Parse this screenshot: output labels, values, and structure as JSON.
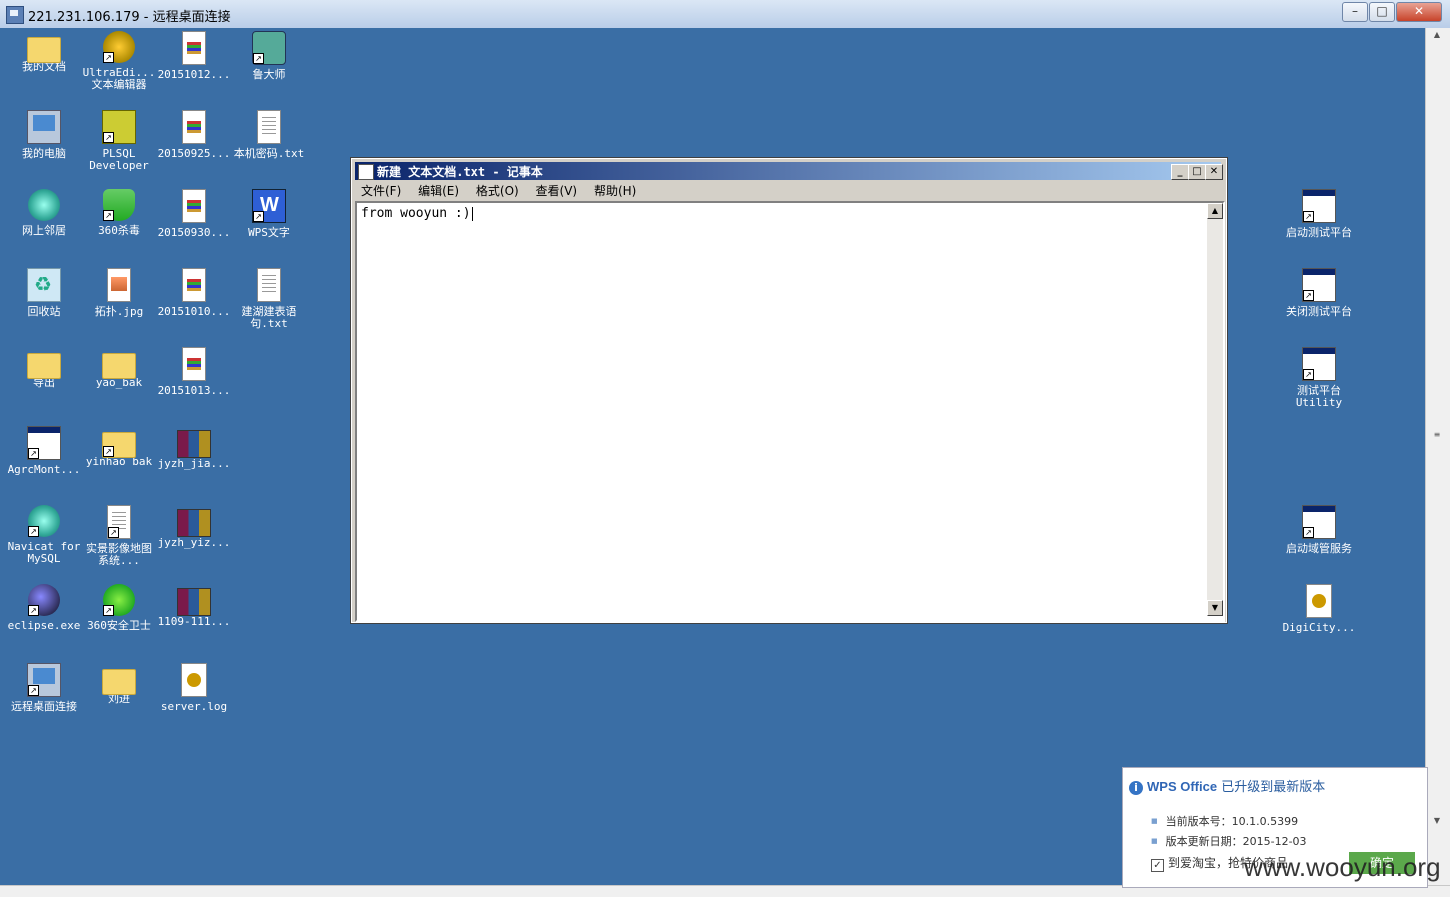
{
  "window": {
    "title": "221.231.106.179 - 远程桌面连接",
    "minimize": "–",
    "maximize": "□",
    "close": "✕"
  },
  "desktop_icons_left": [
    {
      "label": "我的文档",
      "icon": "documents-folder-icon",
      "kind": "folder",
      "shortcut": false
    },
    {
      "label": "UltraEdi... 文本编辑器",
      "icon": "ultraedit-icon",
      "kind": "ue",
      "shortcut": true
    },
    {
      "label": "20151012...",
      "icon": "doc-file-icon",
      "kind": "doc",
      "shortcut": false
    },
    {
      "label": "鲁大师",
      "icon": "ludashi-icon",
      "kind": "ludashi",
      "shortcut": true
    },
    {
      "label": "我的电脑",
      "icon": "my-computer-icon",
      "kind": "computer",
      "shortcut": false
    },
    {
      "label": "PLSQL Developer",
      "icon": "plsql-icon",
      "kind": "plsql",
      "shortcut": true
    },
    {
      "label": "20150925...",
      "icon": "doc-file-icon",
      "kind": "doc",
      "shortcut": false
    },
    {
      "label": "本机密码.txt",
      "icon": "text-file-icon",
      "kind": "txt",
      "shortcut": false
    },
    {
      "label": "网上邻居",
      "icon": "network-icon",
      "kind": "globe",
      "shortcut": false
    },
    {
      "label": "360杀毒",
      "icon": "360-antivirus-icon",
      "kind": "shield",
      "shortcut": true
    },
    {
      "label": "20150930...",
      "icon": "doc-file-icon",
      "kind": "doc",
      "shortcut": false
    },
    {
      "label": "WPS文字",
      "icon": "wps-writer-icon",
      "kind": "wps",
      "shortcut": true
    },
    {
      "label": "回收站",
      "icon": "recycle-bin-icon",
      "kind": "recycle",
      "shortcut": false
    },
    {
      "label": "拓扑.jpg",
      "icon": "image-file-icon",
      "kind": "jpg",
      "shortcut": false
    },
    {
      "label": "20151010...",
      "icon": "doc-file-icon",
      "kind": "doc",
      "shortcut": false
    },
    {
      "label": "建湖建表语句.txt",
      "icon": "text-file-icon",
      "kind": "txt",
      "shortcut": false
    },
    {
      "label": "导出",
      "icon": "folder-icon",
      "kind": "folder",
      "shortcut": false
    },
    {
      "label": "yao_bak",
      "icon": "folder-icon",
      "kind": "folder",
      "shortcut": false
    },
    {
      "label": "20151013...",
      "icon": "doc-file-icon",
      "kind": "doc",
      "shortcut": false
    },
    {
      "label": "",
      "icon": "",
      "kind": "",
      "shortcut": false
    },
    {
      "label": "AgrcMont...",
      "icon": "app-window-icon",
      "kind": "app",
      "shortcut": true
    },
    {
      "label": "yinhao bak",
      "icon": "folder-icon",
      "kind": "folder",
      "shortcut": true
    },
    {
      "label": "jyzh_jia...",
      "icon": "rar-archive-icon",
      "kind": "rar",
      "shortcut": false
    },
    {
      "label": "",
      "icon": "",
      "kind": "",
      "shortcut": false
    },
    {
      "label": "Navicat for MySQL",
      "icon": "navicat-icon",
      "kind": "globe",
      "shortcut": true
    },
    {
      "label": "实景影像地图系统...",
      "icon": "word-doc-icon",
      "kind": "txt",
      "shortcut": true
    },
    {
      "label": "jyzh_yiz...",
      "icon": "rar-archive-icon",
      "kind": "rar",
      "shortcut": false
    },
    {
      "label": "",
      "icon": "",
      "kind": "",
      "shortcut": false
    },
    {
      "label": "eclipse.exe",
      "icon": "eclipse-icon",
      "kind": "roundblue",
      "shortcut": true
    },
    {
      "label": "360安全卫士",
      "icon": "360-safeguard-icon",
      "kind": "roundgreen",
      "shortcut": true
    },
    {
      "label": "1109-111...",
      "icon": "rar-archive-icon",
      "kind": "rar",
      "shortcut": false
    },
    {
      "label": "",
      "icon": "",
      "kind": "",
      "shortcut": false
    },
    {
      "label": "远程桌面连接",
      "icon": "remote-desktop-icon",
      "kind": "computer",
      "shortcut": true
    },
    {
      "label": "刘进",
      "icon": "folder-icon",
      "kind": "folder",
      "shortcut": false
    },
    {
      "label": "server.log",
      "icon": "log-file-icon",
      "kind": "log",
      "shortcut": false
    }
  ],
  "desktop_icons_right": [
    {
      "label": "启动测试平台",
      "icon": "app-shortcut-icon",
      "kind": "app",
      "shortcut": true
    },
    {
      "label": "关闭测试平台",
      "icon": "app-shortcut-icon",
      "kind": "app",
      "shortcut": true
    },
    {
      "label": "测试平台Utility",
      "icon": "app-shortcut-icon",
      "kind": "app",
      "shortcut": true
    },
    {
      "label": "启动域管服务",
      "icon": "app-shortcut-icon",
      "kind": "app",
      "shortcut": true
    },
    {
      "label": "DigiCity...",
      "icon": "log-file-icon",
      "kind": "log",
      "shortcut": false
    }
  ],
  "notepad": {
    "title": "新建 文本文档.txt - 记事本",
    "menu": [
      "文件(F)",
      "编辑(E)",
      "格式(O)",
      "查看(V)",
      "帮助(H)"
    ],
    "content": "from wooyun :)"
  },
  "wps_popup": {
    "brand": "WPS Office",
    "headline": "已升级到最新版本",
    "version": "当前版本号：10.1.0.5399",
    "update_date": "版本更新日期：2015-12-03",
    "checkbox_label": "到爱淘宝，抢特价商品",
    "checkbox_checked": true,
    "ok_button": "确定"
  },
  "watermark": "www.wooyun.org"
}
